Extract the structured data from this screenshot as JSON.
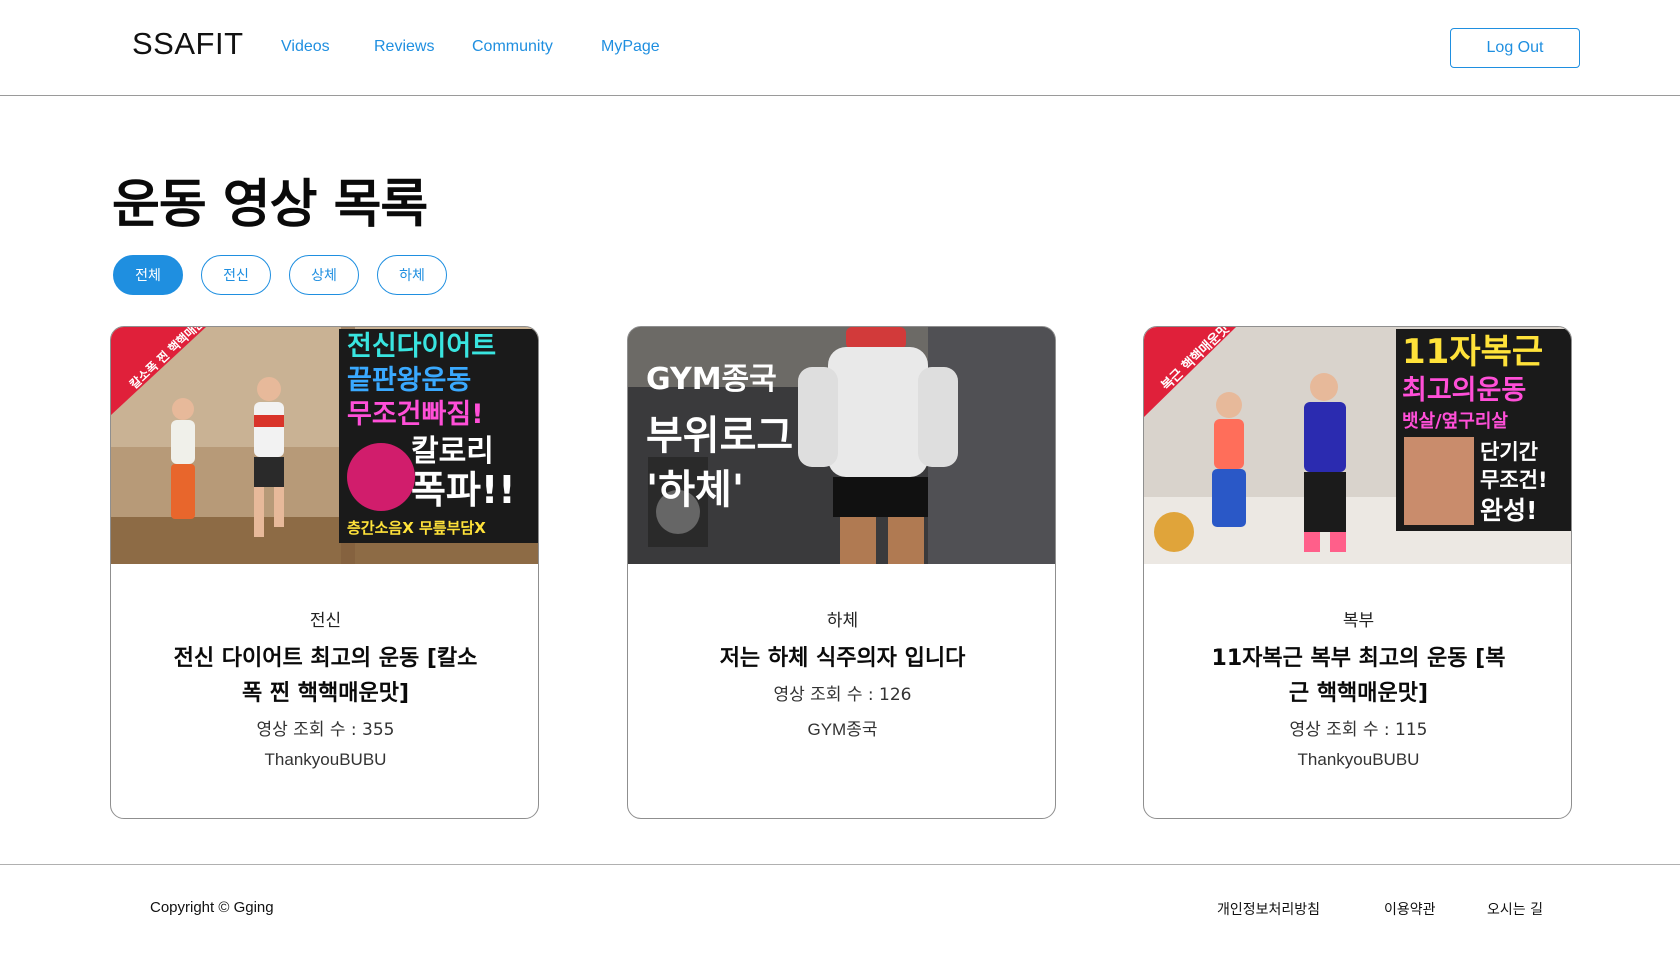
{
  "header": {
    "logo": "SSAFIT",
    "nav": [
      "Videos",
      "Reviews",
      "Community",
      "MyPage"
    ],
    "logout_label": "Log Out"
  },
  "main": {
    "title": "운동 영상 목록",
    "filters": [
      "전체",
      "전신",
      "상체",
      "하체"
    ],
    "active_filter": "전체",
    "videos": [
      {
        "category": "전신",
        "title": "전신 다이어트 최고의 운동 [칼소폭 찐 핵핵매운맛]",
        "views": "영상 조회 수 : 355",
        "channel": "ThankyouBUBU",
        "thumb_text": [
          "전신다이어트",
          "끝판왕운동",
          "무조건빠짐!",
          "칼로리",
          "폭파!!",
          "층간소음X 무릎부담X"
        ],
        "thumb_badge": "칼소폭 찐 핵핵매운맛"
      },
      {
        "category": "하체",
        "title": "저는 하체 식주의자 입니다",
        "views": "영상 조회 수 : 126",
        "channel": "GYM종국",
        "thumb_text": [
          "GYM종국",
          "부위로그",
          "'하체'"
        ]
      },
      {
        "category": "복부",
        "title": "11자복근 복부 최고의 운동 [복근 핵핵매운맛]",
        "views": "영상 조회 수 : 115",
        "channel": "ThankyouBUBU",
        "thumb_text": [
          "11자복근",
          "최고의운동",
          "뱃살/옆구리살",
          "단기간",
          "무조건!",
          "완성!"
        ],
        "thumb_badge": "복근 핵핵매운맛"
      }
    ]
  },
  "footer": {
    "copyright": "Copyright © Gging",
    "links": [
      "개인정보처리방침",
      "이용약관",
      "오시는 길"
    ]
  },
  "colors": {
    "accent": "#1f8fe0",
    "border": "#8f8f8f"
  }
}
